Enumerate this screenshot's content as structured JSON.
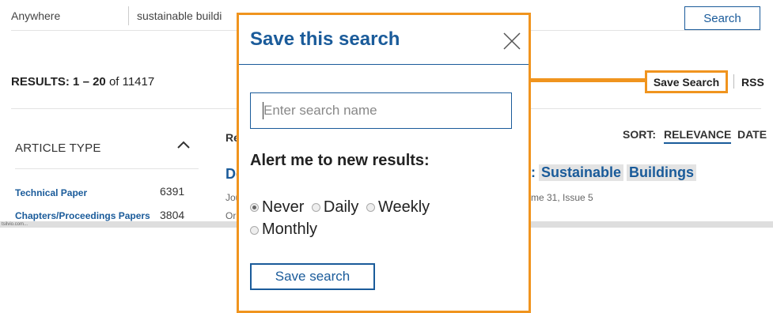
{
  "search_bar": {
    "scope": "Anywhere",
    "query": "sustainable buildi",
    "search_label": "Search"
  },
  "results": {
    "range_prefix": "RESULTS: 1 – 20",
    "of_text": "of 11417"
  },
  "actions": {
    "save_search_label": "Save Search",
    "rss_label": "RSS"
  },
  "facets": {
    "title": "ARTICLE TYPE",
    "items": [
      {
        "label": "Technical Paper",
        "count": "6391"
      },
      {
        "label": "Chapters/Proceedings Papers",
        "count": "3804"
      }
    ]
  },
  "status_text": "tsilvio.com...",
  "main_list": {
    "header_fragment": "Re",
    "title_fragment": "De",
    "journal_fragment": "Jou",
    "other_fragment": "Or",
    "title_tail": ": Sustainable Buildings",
    "title_tail_prefix": ":",
    "title_hl1": "Sustainable",
    "title_hl2": "Buildings",
    "issue_tail": "me 31, Issue 5"
  },
  "sort": {
    "label": "SORT:",
    "relevance": "RELEVANCE",
    "date": "DATE"
  },
  "modal": {
    "title": "Save this search",
    "name_placeholder": "Enter search name",
    "alert_label": "Alert me to new results:",
    "options": [
      {
        "label": "Never",
        "selected": true
      },
      {
        "label": "Daily",
        "selected": false
      },
      {
        "label": "Weekly",
        "selected": false
      },
      {
        "label": "Monthly",
        "selected": false
      }
    ],
    "save_button_label": "Save search"
  },
  "colors": {
    "accent": "#1a5b9a",
    "highlight_border": "#f0941e"
  }
}
